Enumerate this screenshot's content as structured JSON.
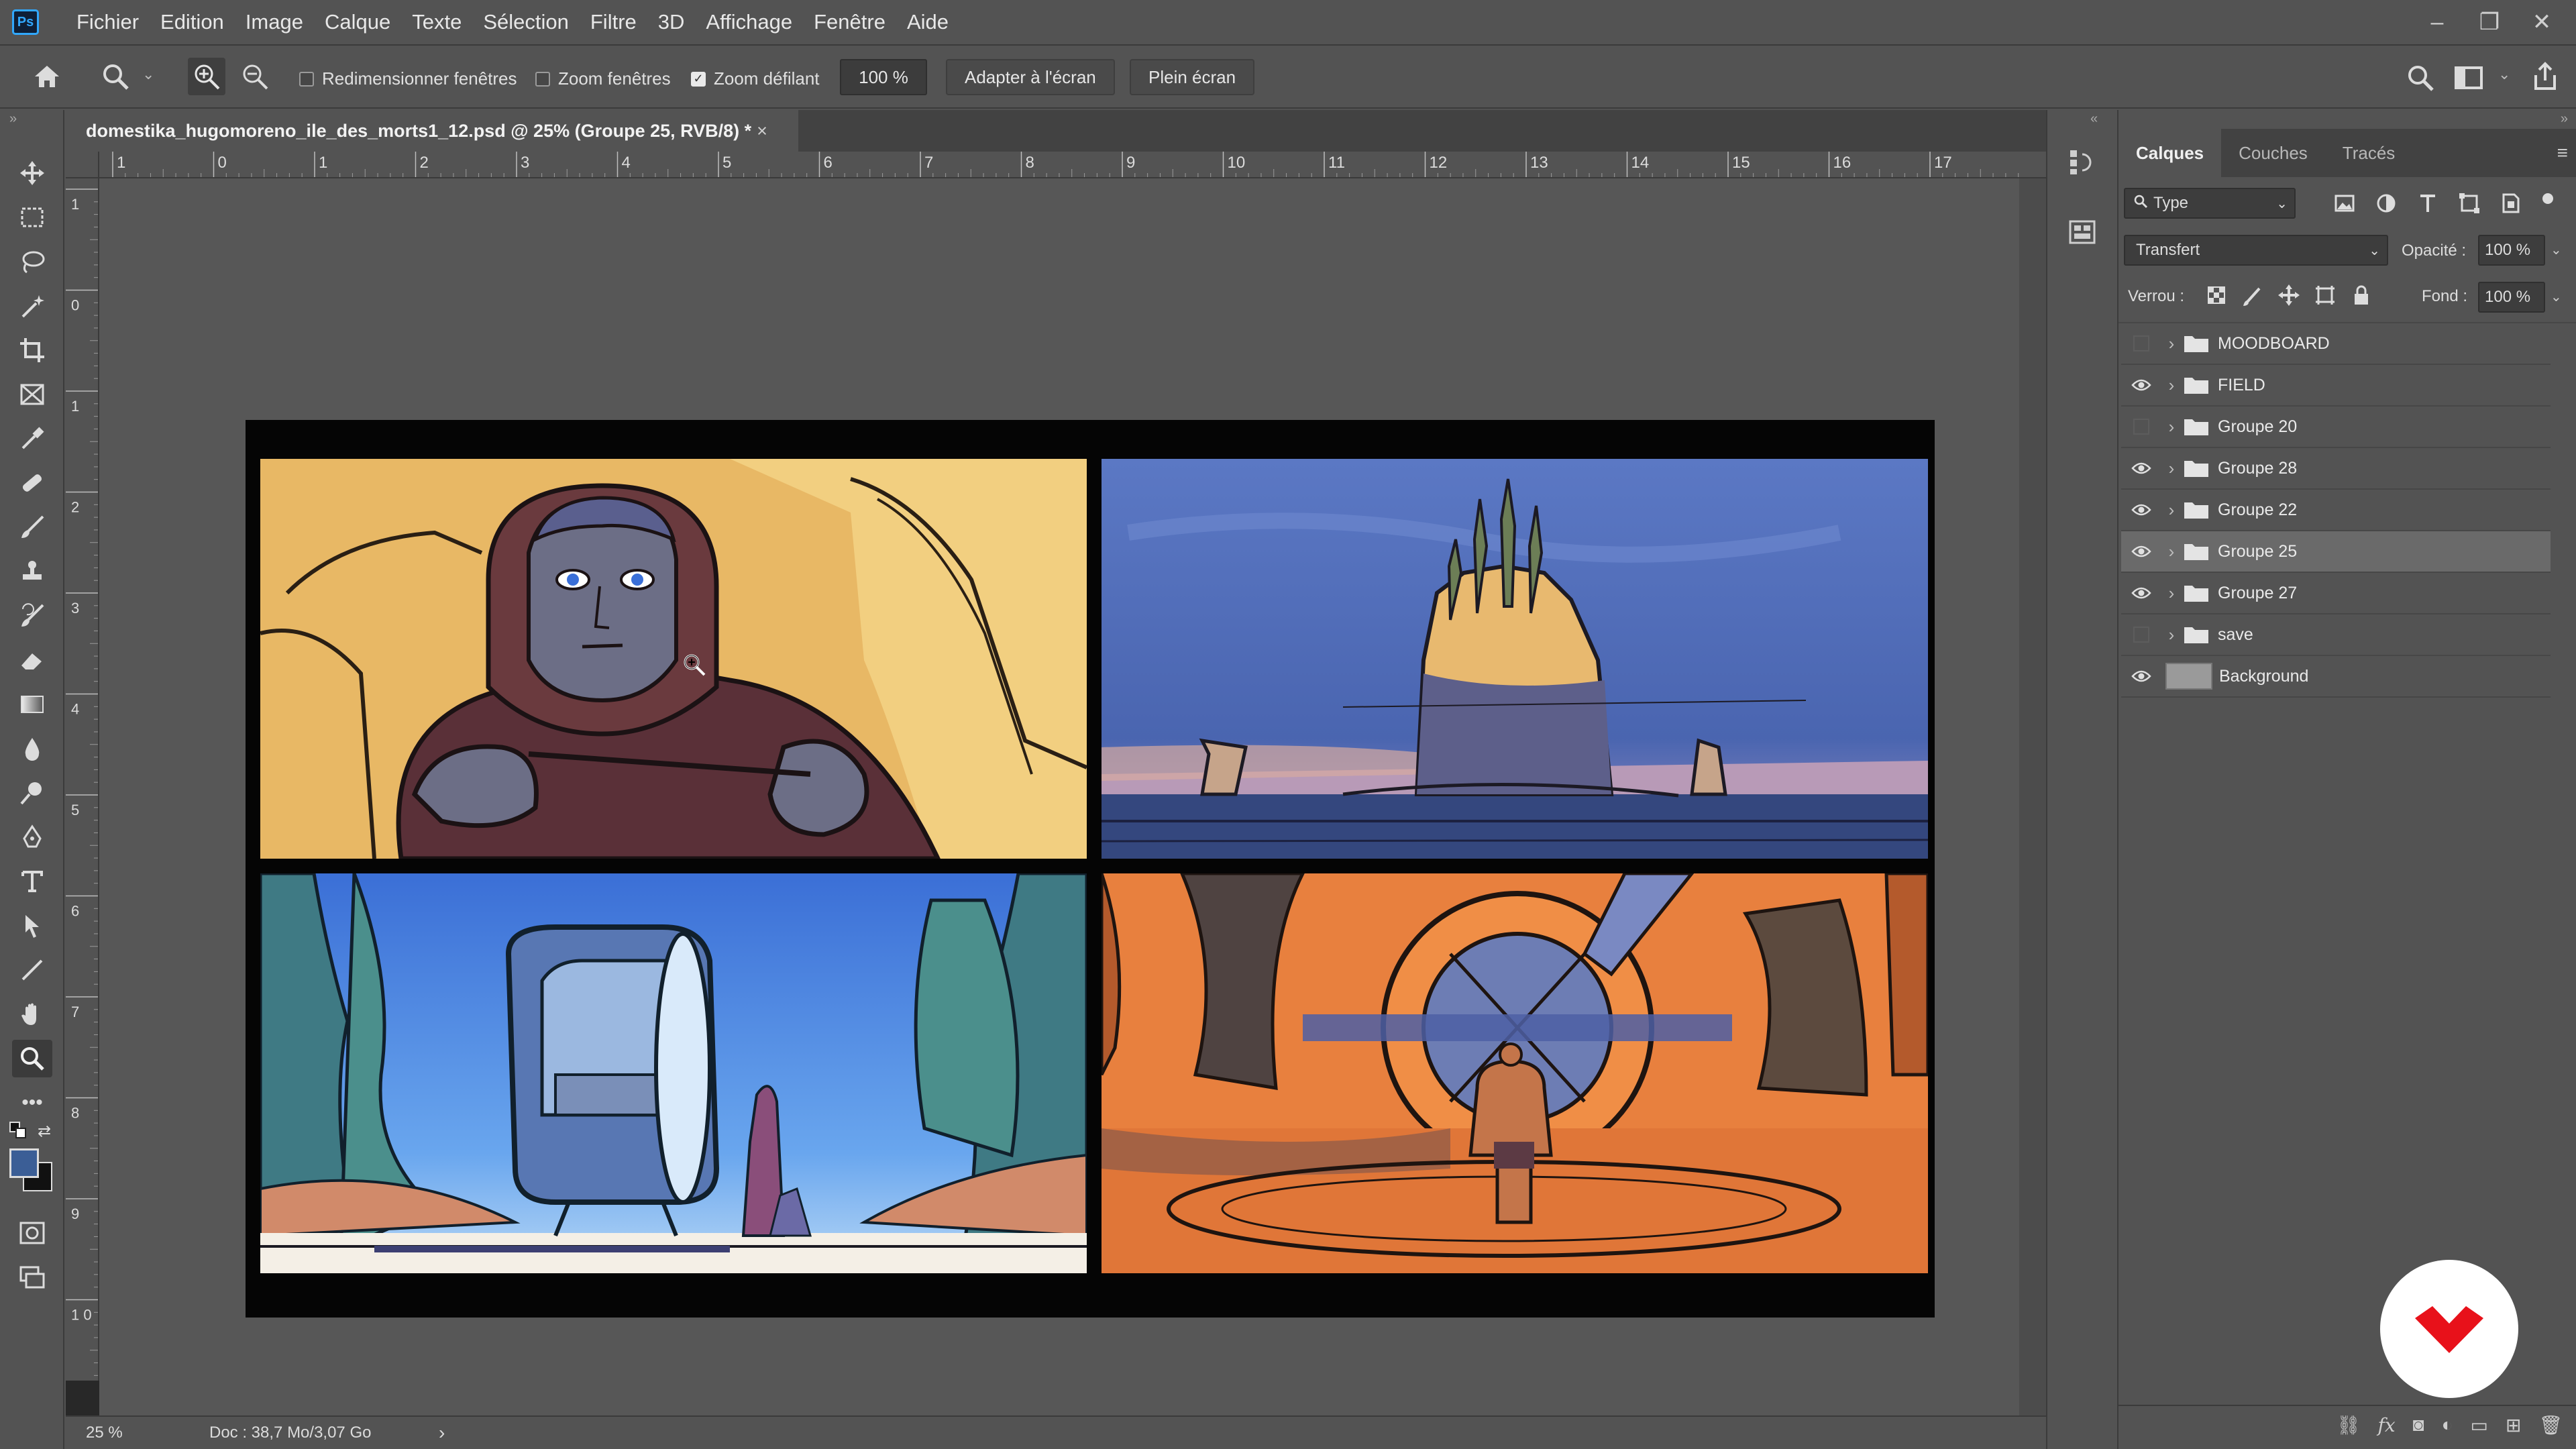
{
  "app": {
    "logo_label": "Ps"
  },
  "menu": [
    "Fichier",
    "Edition",
    "Image",
    "Calque",
    "Texte",
    "Sélection",
    "Filtre",
    "3D",
    "Affichage",
    "Fenêtre",
    "Aide"
  ],
  "window_controls": {
    "minimize": "–",
    "restore": "❐",
    "close": "✕"
  },
  "options": {
    "resize_windows": "Redimensionner fenêtres",
    "zoom_windows": "Zoom fenêtres",
    "scroll_zoom": "Zoom défilant",
    "zoom_value": "100 %",
    "fit_screen": "Adapter à l'écran",
    "full_screen": "Plein écran"
  },
  "document": {
    "title": "domestika_hugomoreno_ile_des_morts1_12.psd @ 25% (Groupe 25, RVB/8) *",
    "close": "×"
  },
  "rulers": {
    "h_labels": [
      "1",
      "0",
      "1",
      "2",
      "3",
      "4",
      "5",
      "6",
      "7",
      "8",
      "9",
      "10",
      "11",
      "12",
      "13",
      "14",
      "15",
      "16",
      "17"
    ],
    "v_labels": [
      "1",
      "0",
      "1",
      "2",
      "3",
      "4",
      "5",
      "6",
      "7",
      "8",
      "9",
      "1 0"
    ]
  },
  "status": {
    "zoom": "25 %",
    "doc": "Doc : 38,7 Mo/3,07 Go",
    "arrow": "›"
  },
  "layers_panel": {
    "tabs": [
      "Calques",
      "Couches",
      "Tracés"
    ],
    "filter_label": "Type",
    "blend_mode": "Transfert",
    "opacity_label": "Opacité :",
    "opacity_value": "100 %",
    "lock_label": "Verrou :",
    "fill_label": "Fond :",
    "fill_value": "100 %",
    "layers": [
      {
        "name": "MOODBOARD",
        "visible": false,
        "type": "group",
        "selected": false
      },
      {
        "name": "FIELD",
        "visible": true,
        "type": "group",
        "selected": false
      },
      {
        "name": "Groupe 20",
        "visible": false,
        "type": "group",
        "selected": false
      },
      {
        "name": "Groupe 28",
        "visible": true,
        "type": "group",
        "selected": false
      },
      {
        "name": "Groupe 22",
        "visible": true,
        "type": "group",
        "selected": false
      },
      {
        "name": "Groupe 25",
        "visible": true,
        "type": "group",
        "selected": true
      },
      {
        "name": "Groupe 27",
        "visible": true,
        "type": "group",
        "selected": false
      },
      {
        "name": "save",
        "visible": false,
        "type": "group",
        "selected": false
      },
      {
        "name": "Background",
        "visible": true,
        "type": "pixel",
        "selected": false
      }
    ]
  },
  "colors": {
    "foreground": "#3b5e96",
    "background": "#111111",
    "accent": "#31a8ff",
    "domestika": "#e8111a"
  }
}
